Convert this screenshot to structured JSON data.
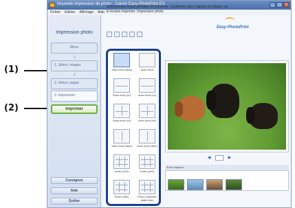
{
  "callouts": {
    "one": "(1)",
    "two": "(2)"
  },
  "window": {
    "title": "Nouvelle impression de photo - Canon Easy-PhotoPrint EX",
    "buttons": [
      "_",
      "□",
      "x"
    ]
  },
  "menu": [
    "Fichier",
    "Édition",
    "Affichage",
    "Aide"
  ],
  "sidebar": {
    "title": "Impression photo",
    "steps": [
      "Menu",
      "1. Sélect. images",
      "2. Sélect. papier",
      "3. Impression"
    ],
    "print_label": "Imprimer",
    "bottom": [
      "Consignes",
      "Aide",
      "Quitter"
    ]
  },
  "header": {
    "text": "Sélectionnez la présentation et imprimez. Confirmez avec l'aperçu et cliquez sur le bouton Imprimer. Impression photo",
    "logo": "Easy-PhotoPrint"
  },
  "layouts": [
    {
      "label": "Sans bord (total)",
      "divs": "none",
      "selected": true
    },
    {
      "label": "Avec bord",
      "divs": "none"
    },
    {
      "label": "Sans bord (x2)",
      "divs": "h"
    },
    {
      "label": "Avec bord (x2)",
      "divs": "h"
    },
    {
      "label": "Sans bord (x4)",
      "divs": "hv"
    },
    {
      "label": "Avec bord (x4)",
      "divs": "hv"
    },
    {
      "label": "Sans bord (ratio)",
      "divs": "v"
    },
    {
      "label": "Avec bord (ratio)",
      "divs": "v"
    },
    {
      "label": "Index (x20)",
      "divs": "grid"
    },
    {
      "label": "Index (x40)",
      "divs": "grid"
    },
    {
      "label": "Index (x80)",
      "divs": "grid"
    },
    {
      "label": "Photo d'identité (taille fixe)",
      "divs": "grid"
    }
  ],
  "filmstrip_label": "Zone d'apercu",
  "colors": {
    "accent": "#1a3d8f",
    "print": "#6aae3b"
  }
}
